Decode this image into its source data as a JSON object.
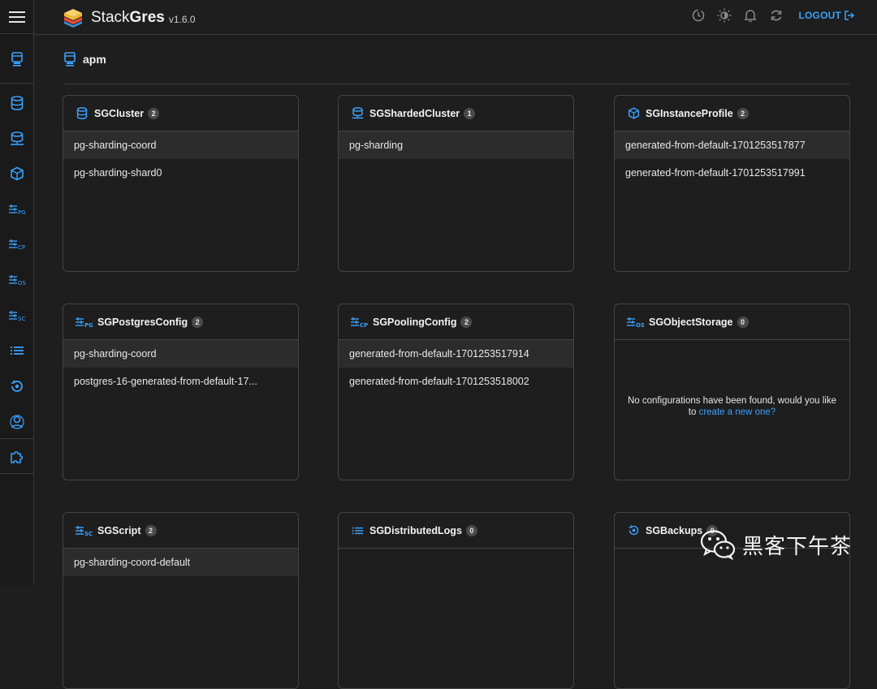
{
  "header": {
    "brand_name_light": "Stack",
    "brand_name_bold": "Gres",
    "version": "v1.6.0",
    "logout_label": "LOGOUT"
  },
  "namespace": {
    "title": "apm"
  },
  "cards": [
    {
      "title": "SGCluster",
      "count": "2",
      "icon": "database-icon",
      "items": [
        "pg-sharding-coord",
        "pg-sharding-shard0"
      ]
    },
    {
      "title": "SGShardedCluster",
      "count": "1",
      "icon": "sharded-database-icon",
      "items": [
        "pg-sharding"
      ]
    },
    {
      "title": "SGInstanceProfile",
      "count": "2",
      "icon": "cube-icon",
      "items": [
        "generated-from-default-1701253517877",
        "generated-from-default-1701253517991"
      ]
    },
    {
      "title": "SGPostgresConfig",
      "count": "2",
      "icon": "postgres-config-icon",
      "items": [
        "pg-sharding-coord",
        "postgres-16-generated-from-default-17..."
      ]
    },
    {
      "title": "SGPoolingConfig",
      "count": "2",
      "icon": "pooling-config-icon",
      "items": [
        "generated-from-default-1701253517914",
        "generated-from-default-1701253518002"
      ]
    },
    {
      "title": "SGObjectStorage",
      "count": "0",
      "icon": "object-storage-icon",
      "items": [],
      "empty_text": "No configurations have been found, would you like to ",
      "empty_link": "create a new one?"
    },
    {
      "title": "SGScript",
      "count": "2",
      "icon": "script-icon",
      "items": [
        "pg-sharding-coord-default"
      ]
    },
    {
      "title": "SGDistributedLogs",
      "count": "0",
      "icon": "list-icon",
      "items": []
    },
    {
      "title": "SGBackups",
      "count": "0",
      "icon": "backup-icon",
      "items": []
    }
  ],
  "watermark": {
    "text": "黑客下午茶"
  },
  "colors": {
    "accent": "#3aa1ff",
    "background": "#1e1e1e",
    "border": "#444444"
  }
}
